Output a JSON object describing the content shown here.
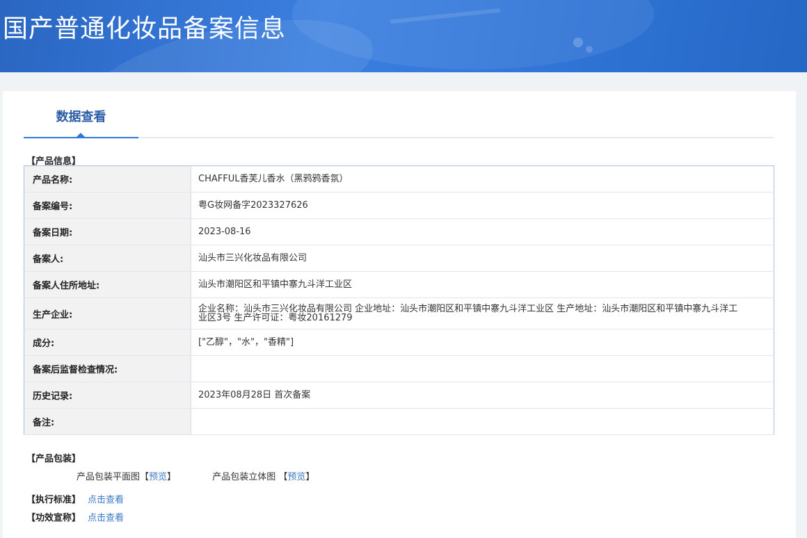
{
  "header": {
    "title": "国产普通化妆品备案信息"
  },
  "tabs": [
    {
      "label": "数据查看",
      "active": true
    }
  ],
  "product_info": {
    "section_title": "【产品信息】",
    "rows": [
      {
        "label": "产品名称:",
        "value": "CHAFFUL香芙儿香水（黑鸦鸦香氛）"
      },
      {
        "label": "备案编号:",
        "value": "粤G妆网备字2023327626"
      },
      {
        "label": "备案日期:",
        "value": "2023-08-16"
      },
      {
        "label": "备案人:",
        "value": "汕头市三兴化妆品有限公司"
      },
      {
        "label": "备案人住所地址:",
        "value": "汕头市潮阳区和平镇中寨九斗洋工业区"
      },
      {
        "label": "生产企业:",
        "value": "企业名称：汕头市三兴化妆品有限公司 企业地址：汕头市潮阳区和平镇中寨九斗洋工业区 生产地址：汕头市潮阳区和平镇中寨九斗洋工业区3号 生产许可证：粤妆20161279"
      },
      {
        "label": "成分:",
        "value": "[\"乙醇\"，\"水\"，\"香精\"]"
      },
      {
        "label": "备案后监督检查情况:",
        "value": ""
      },
      {
        "label": "历史记录:",
        "value": "2023年08月28日 首次备案"
      },
      {
        "label": "备注:",
        "value": ""
      }
    ]
  },
  "packaging": {
    "section_title": "【产品包装】",
    "flat_label": "产品包装平面图",
    "stereo_label": "产品包装立体图",
    "bracket_open": "【",
    "bracket_close": "】",
    "preview_label": "预览"
  },
  "standard": {
    "label": "【执行标准】",
    "link": "点击查看"
  },
  "efficacy": {
    "label": "【功效宣称】",
    "link": "点击查看"
  },
  "colors": {
    "banner": "#2f74d6",
    "tab_active": "#2a5ca8",
    "link": "#3a79c8",
    "table_border": "#a9bedf",
    "label_bg": "#f2f2f2"
  }
}
